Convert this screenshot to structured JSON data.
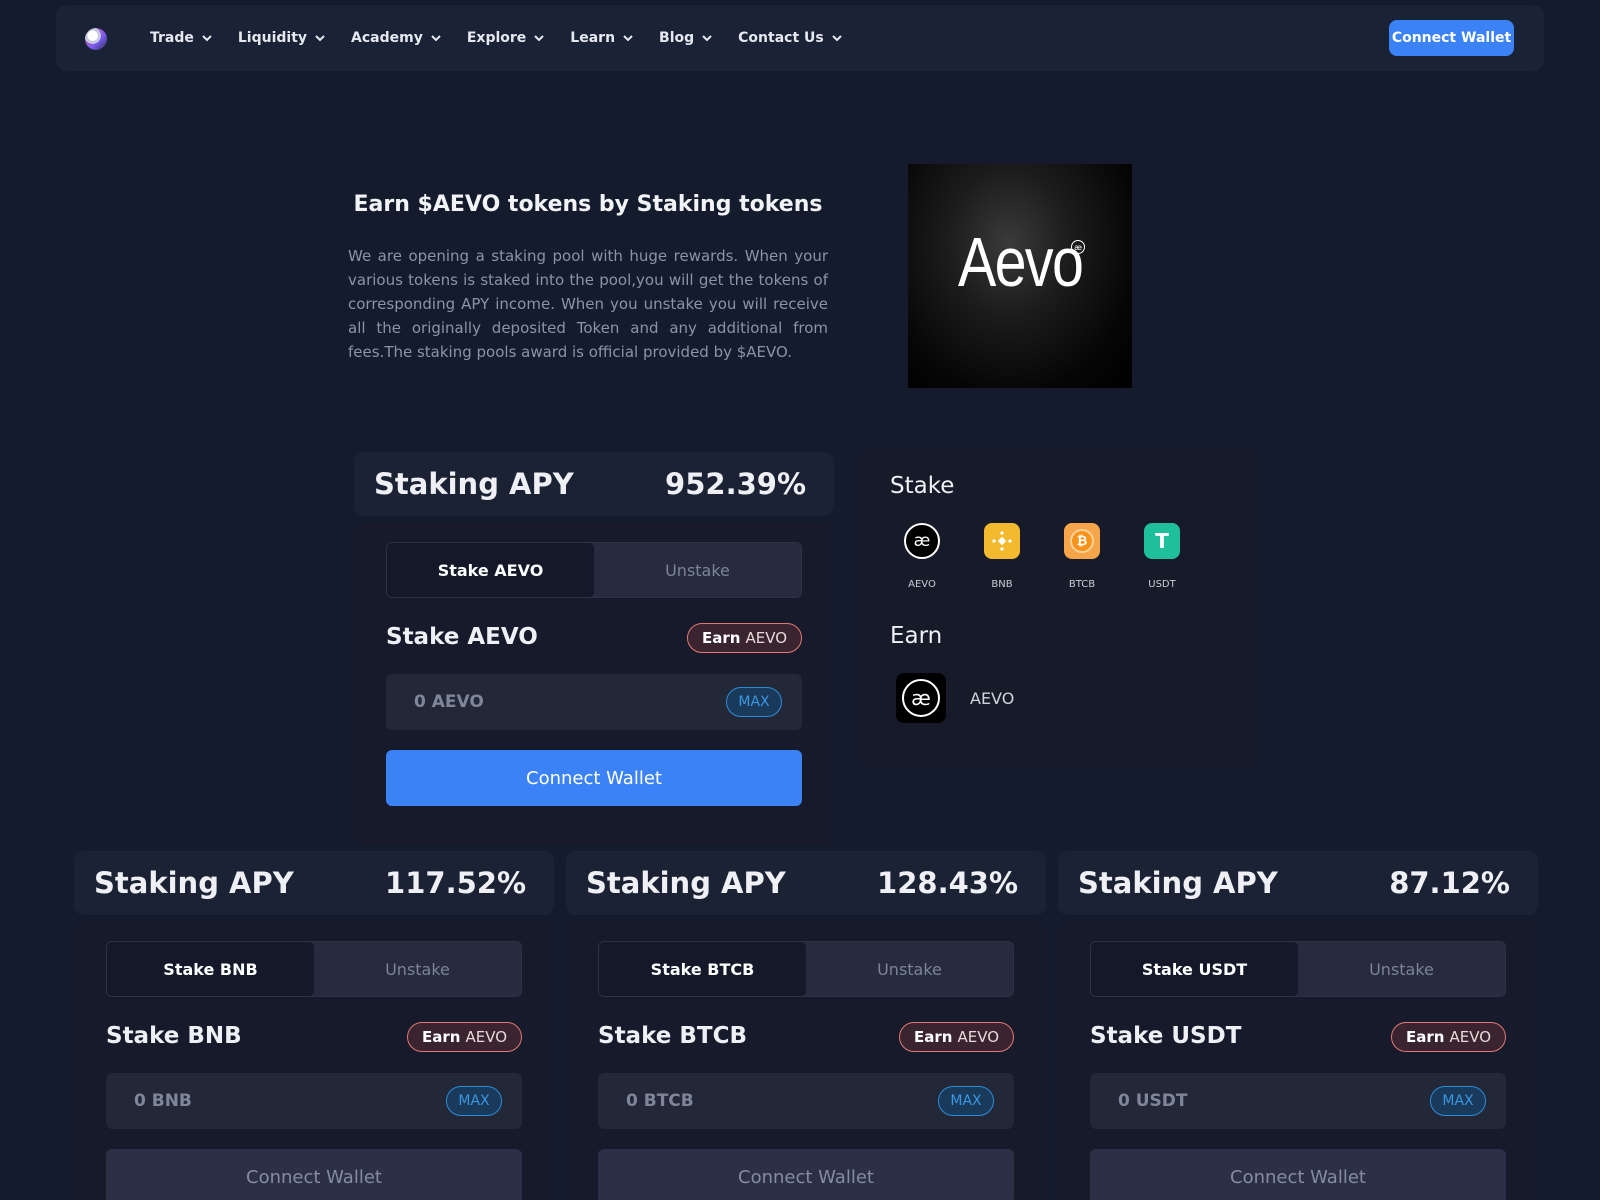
{
  "nav": {
    "items": [
      {
        "label": "Trade"
      },
      {
        "label": "Liquidity"
      },
      {
        "label": "Academy"
      },
      {
        "label": "Explore"
      },
      {
        "label": "Learn"
      },
      {
        "label": "Blog"
      },
      {
        "label": "Contact Us"
      }
    ],
    "connect_label": "Connect Wallet"
  },
  "hero": {
    "title": "Earn $AEVO tokens by Staking tokens",
    "description": "We are opening a staking pool with huge rewards. When your various tokens is staked into the pool,you will get the tokens of corresponding APY income. When you unstake you will receive all the originally deposited Token and any additional from fees.The staking pools award is official provided by $AEVO.",
    "image_brand": "Aevo"
  },
  "pools": [
    {
      "apy_label": "Staking APY",
      "apy": "952.39%",
      "tab_stake": "Stake AEVO",
      "tab_unstake": "Unstake",
      "title": "Stake AEVO",
      "earn_a": "Earn",
      "earn_b": "AEVO",
      "amount": "0 AEVO",
      "max": "MAX",
      "connect": "Connect Wallet"
    },
    {
      "apy_label": "Staking APY",
      "apy": "117.52%",
      "tab_stake": "Stake BNB",
      "tab_unstake": "Unstake",
      "title": "Stake BNB",
      "earn_a": "Earn",
      "earn_b": "AEVO",
      "amount": "0 BNB",
      "max": "MAX",
      "connect": "Connect Wallet"
    },
    {
      "apy_label": "Staking APY",
      "apy": "128.43%",
      "tab_stake": "Stake BTCB",
      "tab_unstake": "Unstake",
      "title": "Stake BTCB",
      "earn_a": "Earn",
      "earn_b": "AEVO",
      "amount": "0 BTCB",
      "max": "MAX",
      "connect": "Connect Wallet"
    },
    {
      "apy_label": "Staking APY",
      "apy": "87.12%",
      "tab_stake": "Stake USDT",
      "tab_unstake": "Unstake",
      "title": "Stake USDT",
      "earn_a": "Earn",
      "earn_b": "AEVO",
      "amount": "0 USDT",
      "max": "MAX",
      "connect": "Connect Wallet"
    }
  ],
  "info": {
    "stake_heading": "Stake",
    "tokens": [
      {
        "label": "AEVO",
        "icon": "aevo-icon",
        "color": "#000000"
      },
      {
        "label": "BNB",
        "icon": "bnb-icon",
        "color": "#f3ba2f"
      },
      {
        "label": "BTCB",
        "icon": "btcb-icon",
        "color": "#f7931a"
      },
      {
        "label": "USDT",
        "icon": "usdt-icon",
        "color": "#26a17b"
      }
    ],
    "earn_heading": "Earn",
    "earn_token": "AEVO"
  },
  "colors": {
    "accent": "#3b82f6",
    "background": "#141b2d"
  }
}
